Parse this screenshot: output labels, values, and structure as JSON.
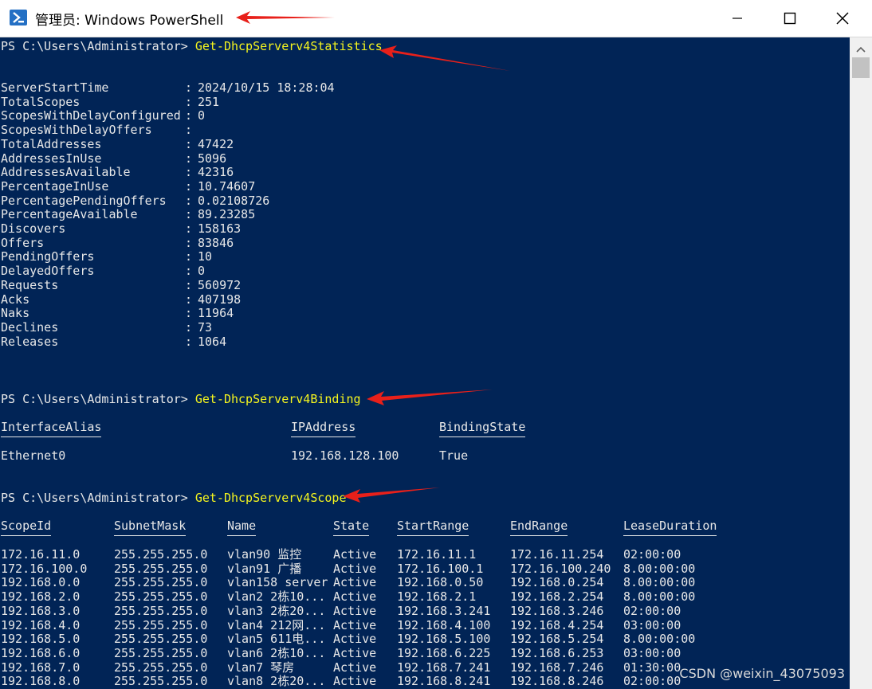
{
  "window": {
    "title": "管理员: Windows PowerShell",
    "buttons": {
      "minimize": "minimize",
      "maximize": "maximize",
      "close": "close"
    }
  },
  "prompt": "PS C:\\Users\\Administrator> ",
  "commands": {
    "stats": "Get-DhcpServerv4Statistics",
    "binding": "Get-DhcpServerv4Binding",
    "scope": "Get-DhcpServerv4Scope"
  },
  "statistics": [
    {
      "key": "ServerStartTime",
      "value": "2024/10/15 18:28:04"
    },
    {
      "key": "TotalScopes",
      "value": "251"
    },
    {
      "key": "ScopesWithDelayConfigured",
      "value": "0"
    },
    {
      "key": "ScopesWithDelayOffers",
      "value": ""
    },
    {
      "key": "TotalAddresses",
      "value": "47422"
    },
    {
      "key": "AddressesInUse",
      "value": "5096"
    },
    {
      "key": "AddressesAvailable",
      "value": "42316"
    },
    {
      "key": "PercentageInUse",
      "value": "10.74607"
    },
    {
      "key": "PercentagePendingOffers",
      "value": "0.02108726"
    },
    {
      "key": "PercentageAvailable",
      "value": "89.23285"
    },
    {
      "key": "Discovers",
      "value": "158163"
    },
    {
      "key": "Offers",
      "value": "83846"
    },
    {
      "key": "PendingOffers",
      "value": "10"
    },
    {
      "key": "DelayedOffers",
      "value": "0"
    },
    {
      "key": "Requests",
      "value": "560972"
    },
    {
      "key": "Acks",
      "value": "407198"
    },
    {
      "key": "Naks",
      "value": "11964"
    },
    {
      "key": "Declines",
      "value": "73"
    },
    {
      "key": "Releases",
      "value": "1064"
    }
  ],
  "binding": {
    "headers": [
      "InterfaceAlias",
      "IPAddress",
      "BindingState"
    ],
    "rows": [
      [
        "Ethernet0",
        "192.168.128.100",
        "True"
      ]
    ]
  },
  "scope": {
    "headers": [
      "ScopeId",
      "SubnetMask",
      "Name",
      "State",
      "StartRange",
      "EndRange",
      "LeaseDuration"
    ],
    "rows": [
      [
        "172.16.11.0",
        "255.255.255.0",
        "vlan90 监控",
        "Active",
        "172.16.11.1",
        "172.16.11.254",
        "02:00:00"
      ],
      [
        "172.16.100.0",
        "255.255.255.0",
        "vlan91 广播",
        "Active",
        "172.16.100.1",
        "172.16.100.240",
        "8.00:00:00"
      ],
      [
        "192.168.0.0",
        "255.255.255.0",
        "vlan158 server",
        "Active",
        "192.168.0.50",
        "192.168.0.254",
        "8.00:00:00"
      ],
      [
        "192.168.2.0",
        "255.255.255.0",
        "vlan2 2栋10...",
        "Active",
        "192.168.2.1",
        "192.168.2.254",
        "8.00:00:00"
      ],
      [
        "192.168.3.0",
        "255.255.255.0",
        "vlan3 2栋20...",
        "Active",
        "192.168.3.241",
        "192.168.3.246",
        "02:00:00"
      ],
      [
        "192.168.4.0",
        "255.255.255.0",
        "vlan4 212网...",
        "Active",
        "192.168.4.100",
        "192.168.4.254",
        "03:00:00"
      ],
      [
        "192.168.5.0",
        "255.255.255.0",
        "vlan5 611电...",
        "Active",
        "192.168.5.100",
        "192.168.5.254",
        "8.00:00:00"
      ],
      [
        "192.168.6.0",
        "255.255.255.0",
        "vlan6 2栋10...",
        "Active",
        "192.168.6.225",
        "192.168.6.253",
        "03:00:00"
      ],
      [
        "192.168.7.0",
        "255.255.255.0",
        "vlan7 琴房",
        "Active",
        "192.168.7.241",
        "192.168.7.246",
        "01:30:00"
      ],
      [
        "192.168.8.0",
        "255.255.255.0",
        "vlan8 2栋20...",
        "Active",
        "192.168.8.241",
        "192.168.8.246",
        "02:00:00"
      ]
    ]
  },
  "watermark": "CSDN @weixin_43075093",
  "colors": {
    "console_bg": "#012456",
    "command": "#f5f51e",
    "annotation_arrow": "#e8201a"
  }
}
